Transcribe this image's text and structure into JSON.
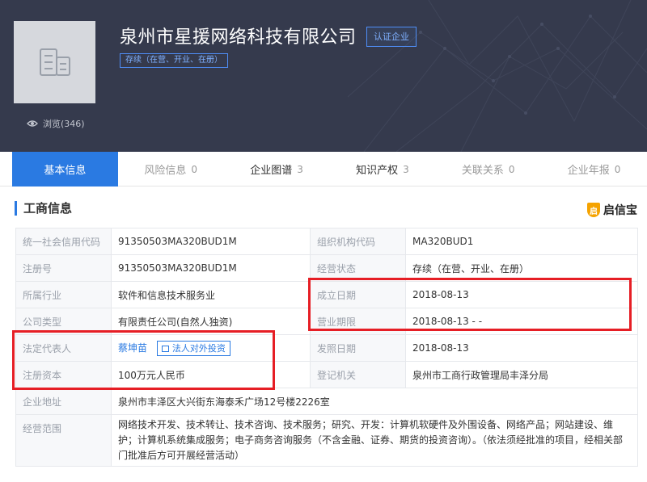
{
  "header": {
    "company_name": "泉州市星援网络科技有限公司",
    "cert_label": "认证企业",
    "status_tag": "存续（在营、开业、在册）",
    "views_label": "浏览(346)"
  },
  "tabs": [
    {
      "label": "基本信息",
      "count": ""
    },
    {
      "label": "风险信息",
      "count": "0"
    },
    {
      "label": "企业图谱",
      "count": "3"
    },
    {
      "label": "知识产权",
      "count": "3"
    },
    {
      "label": "关联关系",
      "count": "0"
    },
    {
      "label": "企业年报",
      "count": "0"
    }
  ],
  "section": {
    "title": "工商信息",
    "brand": "启信宝",
    "brand_mark": "启"
  },
  "info": {
    "credit_code_label": "统一社会信用代码",
    "credit_code": "91350503MA320BUD1M",
    "org_code_label": "组织机构代码",
    "org_code": "MA320BUD1",
    "reg_no_label": "注册号",
    "reg_no": "91350503MA320BUD1M",
    "biz_status_label": "经营状态",
    "biz_status": "存续（在营、开业、在册）",
    "industry_label": "所属行业",
    "industry": "软件和信息技术服务业",
    "founded_label": "成立日期",
    "founded": "2018-08-13",
    "company_type_label": "公司类型",
    "company_type": "有限责任公司(自然人独资)",
    "term_label": "营业期限",
    "term": "2018-08-13 - -",
    "legal_rep_label": "法定代表人",
    "legal_rep": "蔡坤苗",
    "legal_rep_btn": "法人对外投资",
    "issue_date_label": "发照日期",
    "issue_date": "2018-08-13",
    "capital_label": "注册资本",
    "capital": "100万元人民币",
    "authority_label": "登记机关",
    "authority": "泉州市工商行政管理局丰泽分局",
    "address_label": "企业地址",
    "address": "泉州市丰泽区大兴街东海泰禾广场12号楼2226室",
    "scope_label": "经营范围",
    "scope": "网络技术开发、技术转让、技术咨询、技术服务；研究、开发：计算机软硬件及外围设备、网络产品；网站建设、维护；计算机系统集成服务；电子商务咨询服务（不含金融、证券、期货的投资咨询）。（依法须经批准的项目，经相关部门批准后方可开展经营活动）"
  },
  "colors": {
    "header_bg": "#353a4d",
    "accent": "#2a7ae2",
    "annotation_red": "#e61e25",
    "brand_orange": "#f5a300"
  }
}
